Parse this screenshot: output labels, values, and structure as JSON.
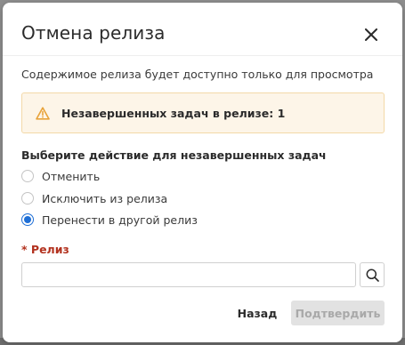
{
  "dialog": {
    "title": "Отмена релиза",
    "subtitle": "Содержимое релиза будет доступно только для просмотра"
  },
  "warning": {
    "icon": "warning-triangle-icon",
    "text": "Незавершенных задач в релизе: 1"
  },
  "action_section": {
    "label": "Выберите действие для незавершенных задач",
    "options": [
      {
        "label": "Отменить",
        "checked": false
      },
      {
        "label": "Исключить из релиза",
        "checked": false
      },
      {
        "label": "Перенести в другой релиз",
        "checked": true
      }
    ]
  },
  "release_field": {
    "required_mark": "*",
    "label": "Релиз",
    "value": "",
    "placeholder": ""
  },
  "footer": {
    "back_label": "Назад",
    "confirm_label": "Подтвердить"
  },
  "colors": {
    "accent": "#1f6fd6",
    "warning_bg": "#fdf5e8",
    "warning_icon": "#e8a33b",
    "required": "#b3321f",
    "disabled_bg": "#e2e2e2"
  }
}
